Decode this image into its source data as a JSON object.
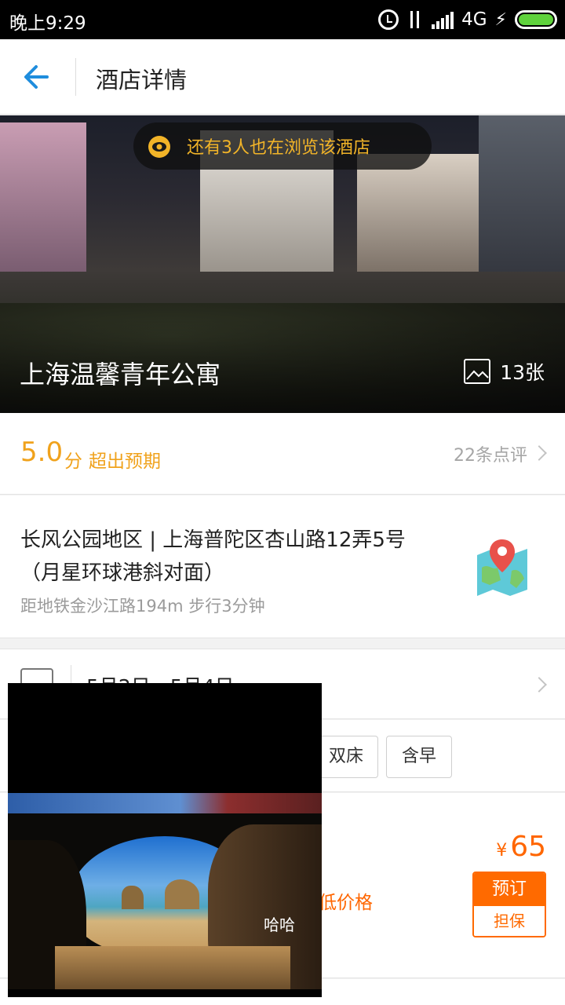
{
  "status_bar": {
    "time": "晚上9:29",
    "network": "4G",
    "icons": [
      "alarm-icon",
      "data-arrows-icon",
      "signal-icon",
      "charging-icon",
      "battery-icon"
    ],
    "battery_color": "#5fd23c"
  },
  "header": {
    "title": "酒店详情",
    "back_icon": "back-arrow-icon",
    "accent": "#1f8ddd"
  },
  "hero": {
    "browsing_notice": "还有3人也在浏览该酒店",
    "hotel_name": "上海温馨青年公寓",
    "photo_count": "13张"
  },
  "rating": {
    "score": "5.0",
    "score_unit": "分",
    "label": "超出预期",
    "reviews": "22条点评",
    "color": "#f0a21c"
  },
  "address": {
    "text": "长风公园地区 | 上海普陀区杏山路12弄5号（月星环球港斜对面）",
    "metro": "距地铁金沙江路194m 步行3分钟",
    "map_icon": "map-pin-icon"
  },
  "dates": {
    "range": "5月2日 - 5月4日"
  },
  "filters": {
    "chips": [
      "双床",
      "含早"
    ]
  },
  "room": {
    "low_price_label": "低价格",
    "currency": "¥",
    "price": "65",
    "book_label": "预订",
    "guarantee_label": "担保",
    "price_color": "#ff6600"
  },
  "overlay": {
    "caption": "哈哈"
  }
}
